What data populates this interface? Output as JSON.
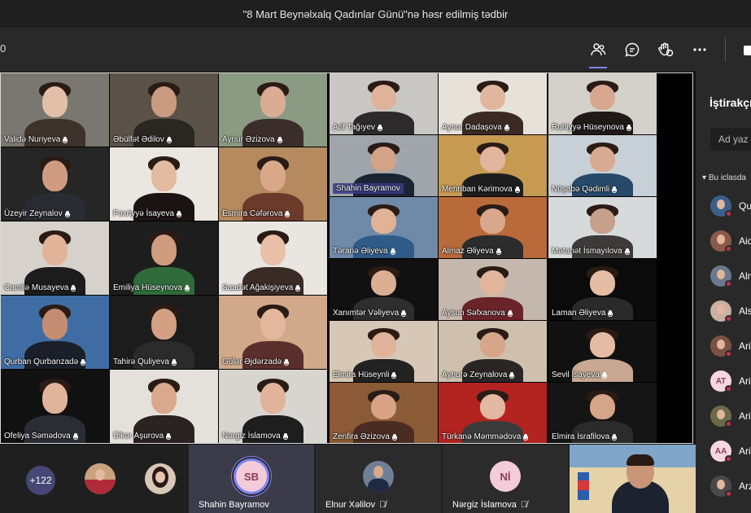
{
  "window": {
    "title": "\"8 Mart Beynəlxalq Qadınlar Günü\"nə həsr edilmiş tədbir"
  },
  "toolbar": {
    "timer_fragment": "0"
  },
  "grid": {
    "tiles": [
      {
        "name": "Validə Nuriyeva"
      },
      {
        "name": "Əbülfət Ədilov"
      },
      {
        "name": "Aynur Əzizova"
      },
      {
        "name": "Arif Tağıyev"
      },
      {
        "name": "Aynur Dadaşova"
      },
      {
        "name": "Ruhiyyə Hüseynova"
      },
      {
        "name": "Üzeyir Zeynalov"
      },
      {
        "name": "Fəxriyyə İsayeva"
      },
      {
        "name": "Esmira Cəfərova"
      },
      {
        "name": "Shahin Bayramov"
      },
      {
        "name": "Mehriban Kərimova"
      },
      {
        "name": "Nüşabə Qədimli"
      },
      {
        "name": "Camilə Musayeva"
      },
      {
        "name": "Emiliya Hüseynova"
      },
      {
        "name": "Saadət Ağakişiyeva"
      },
      {
        "name": "Təranə Əliyeva"
      },
      {
        "name": "Almaz Əliyeva"
      },
      {
        "name": "Mətanət İsmayılova"
      },
      {
        "name": "Xanımtər Vəliyeva"
      },
      {
        "name": "Aysun Səfxanova"
      },
      {
        "name": "Laman Əliyeva"
      },
      {
        "name": "Qurban Qurbanzadə"
      },
      {
        "name": "Tahirə Quliyeva"
      },
      {
        "name": "Gülər Əjdərzadə"
      },
      {
        "name": "Elmira Hüseynli"
      },
      {
        "name": "Aynurə Zeynalova"
      },
      {
        "name": "Sevil İsayeva"
      },
      {
        "name": "Ofeliya Səmədova"
      },
      {
        "name": "Ülkər Aşurova"
      },
      {
        "name": "Nərgiz İslamova"
      },
      {
        "name": "Zenfira Əzizova"
      },
      {
        "name": "Türkanə Məmmədova"
      },
      {
        "name": "Elmira İsrafilova"
      }
    ]
  },
  "panel": {
    "title": "İştirakçılar",
    "search_placeholder": "Ad yaz",
    "section": "Bu iclasda",
    "participants": [
      {
        "name": "Qu"
      },
      {
        "name": "Aid"
      },
      {
        "name": "Alm"
      },
      {
        "name": "Als"
      },
      {
        "name": "Ari"
      },
      {
        "name": "Ari",
        "initials": "AT"
      },
      {
        "name": "Ari"
      },
      {
        "name": "Ari",
        "initials": "AA"
      },
      {
        "name": "Arz"
      }
    ]
  },
  "bottom_bar": {
    "overflow": "+122",
    "tiles": [
      {
        "name": "Shahin Bayramov",
        "initials": "SB"
      },
      {
        "name": "Elnur Xəlilov"
      },
      {
        "name": "Nərgiz İslamova",
        "initials": "Nİ"
      }
    ]
  },
  "colors": {
    "accent": "#7f85f5",
    "panel": "#292929",
    "presence_busy": "#c4314b",
    "avatar_purple": "#464775"
  }
}
